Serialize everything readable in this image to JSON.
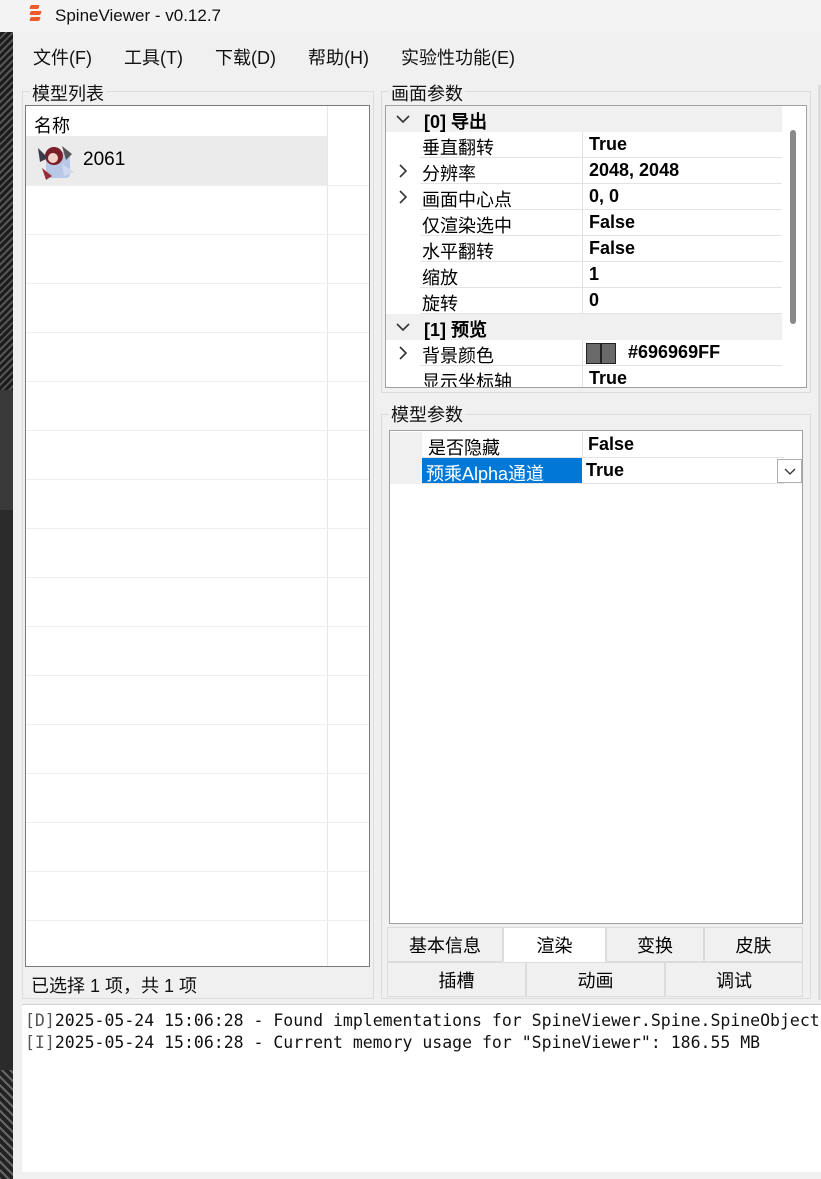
{
  "window": {
    "title": "SpineViewer - v0.12.7"
  },
  "menubar": {
    "items": [
      "文件(F)",
      "工具(T)",
      "下载(D)",
      "帮助(H)",
      "实验性功能(E)"
    ]
  },
  "model_list": {
    "group_title": "模型列表",
    "column_header": "名称",
    "items": [
      {
        "name": "2061"
      }
    ],
    "status": "已选择 1 项，共 1 项"
  },
  "canvas_params": {
    "group_title": "画面参数",
    "rows": [
      {
        "kind": "category",
        "label": "[0] 导出",
        "expander": "chevron-down"
      },
      {
        "kind": "prop",
        "label": "垂直翻转",
        "value": "True"
      },
      {
        "kind": "prop",
        "label": "分辨率",
        "value": "2048, 2048",
        "expander": "chevron-right"
      },
      {
        "kind": "prop",
        "label": "画面中心点",
        "value": "0, 0",
        "expander": "chevron-right"
      },
      {
        "kind": "prop",
        "label": "仅渲染选中",
        "value": "False"
      },
      {
        "kind": "prop",
        "label": "水平翻转",
        "value": "False"
      },
      {
        "kind": "prop",
        "label": "缩放",
        "value": "1"
      },
      {
        "kind": "prop",
        "label": "旋转",
        "value": "0"
      },
      {
        "kind": "category",
        "label": "[1] 预览",
        "expander": "chevron-down"
      },
      {
        "kind": "prop",
        "label": "背景颜色",
        "value": "#696969FF",
        "expander": "chevron-right",
        "swatch_color": "#696969"
      },
      {
        "kind": "prop",
        "label": "显示坐标轴",
        "value": "True"
      }
    ]
  },
  "model_params": {
    "group_title": "模型参数",
    "rows": [
      {
        "label": "是否隐藏",
        "value": "False"
      },
      {
        "label": "预乘Alpha通道",
        "value": "True",
        "selected": true
      }
    ],
    "selection_color": "#0078d7"
  },
  "tabs": {
    "row1": [
      "基本信息",
      "渲染",
      "变换",
      "皮肤"
    ],
    "row2": [
      "插槽",
      "动画",
      "调试"
    ],
    "active": "渲染"
  },
  "log": {
    "lines": [
      {
        "level": "[D]",
        "text": "2025-05-24 15:06:28 - Found implementations for SpineViewer.Spine.SpineObject"
      },
      {
        "level": "[I]",
        "text": "2025-05-24 15:06:28 - Current memory usage for \"SpineViewer\": 186.55 MB"
      }
    ]
  },
  "colors": {
    "accent": "#ef5a28",
    "window_bg": "#f0f0f0"
  }
}
